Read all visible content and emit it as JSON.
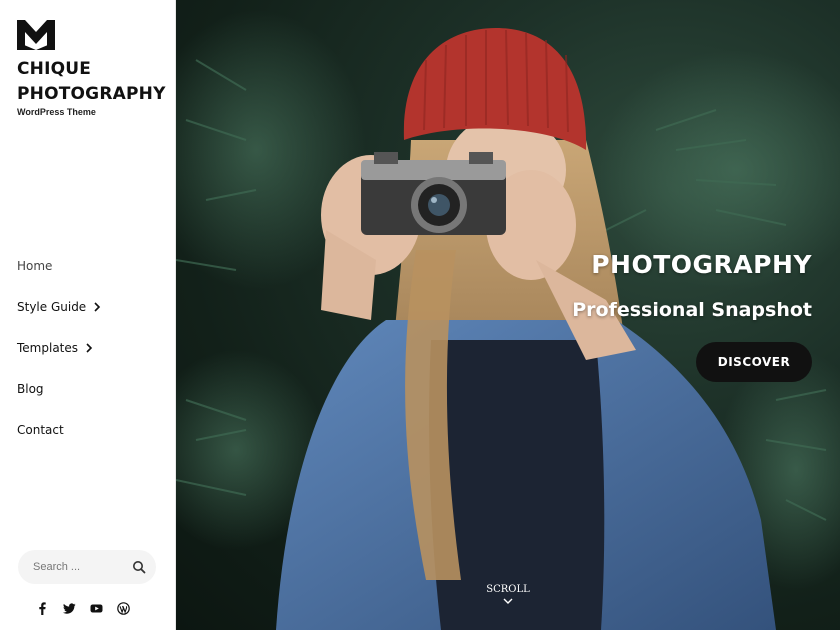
{
  "site": {
    "title_line1": "CHIQUE",
    "title_line2": "PHOTOGRAPHY",
    "tagline": "WordPress Theme"
  },
  "nav": {
    "items": [
      {
        "label": "Home",
        "has_submenu": false
      },
      {
        "label": "Style Guide",
        "has_submenu": true
      },
      {
        "label": "Templates",
        "has_submenu": true
      },
      {
        "label": "Blog",
        "has_submenu": false
      },
      {
        "label": "Contact",
        "has_submenu": false
      }
    ]
  },
  "search": {
    "placeholder": "Search ...",
    "icon": "search-icon"
  },
  "social": [
    "facebook-icon",
    "twitter-icon",
    "youtube-icon",
    "wordpress-icon"
  ],
  "hero": {
    "title": "PHOTOGRAPHY",
    "subtitle": "Professional Snapshot",
    "button_label": "DISCOVER",
    "scroll_label": "SCROLL"
  },
  "colors": {
    "accent": "#111111",
    "sidebar_bg": "#ffffff",
    "text": "#111111",
    "hat": "#b3342d",
    "jacket": "#4f74a6"
  }
}
